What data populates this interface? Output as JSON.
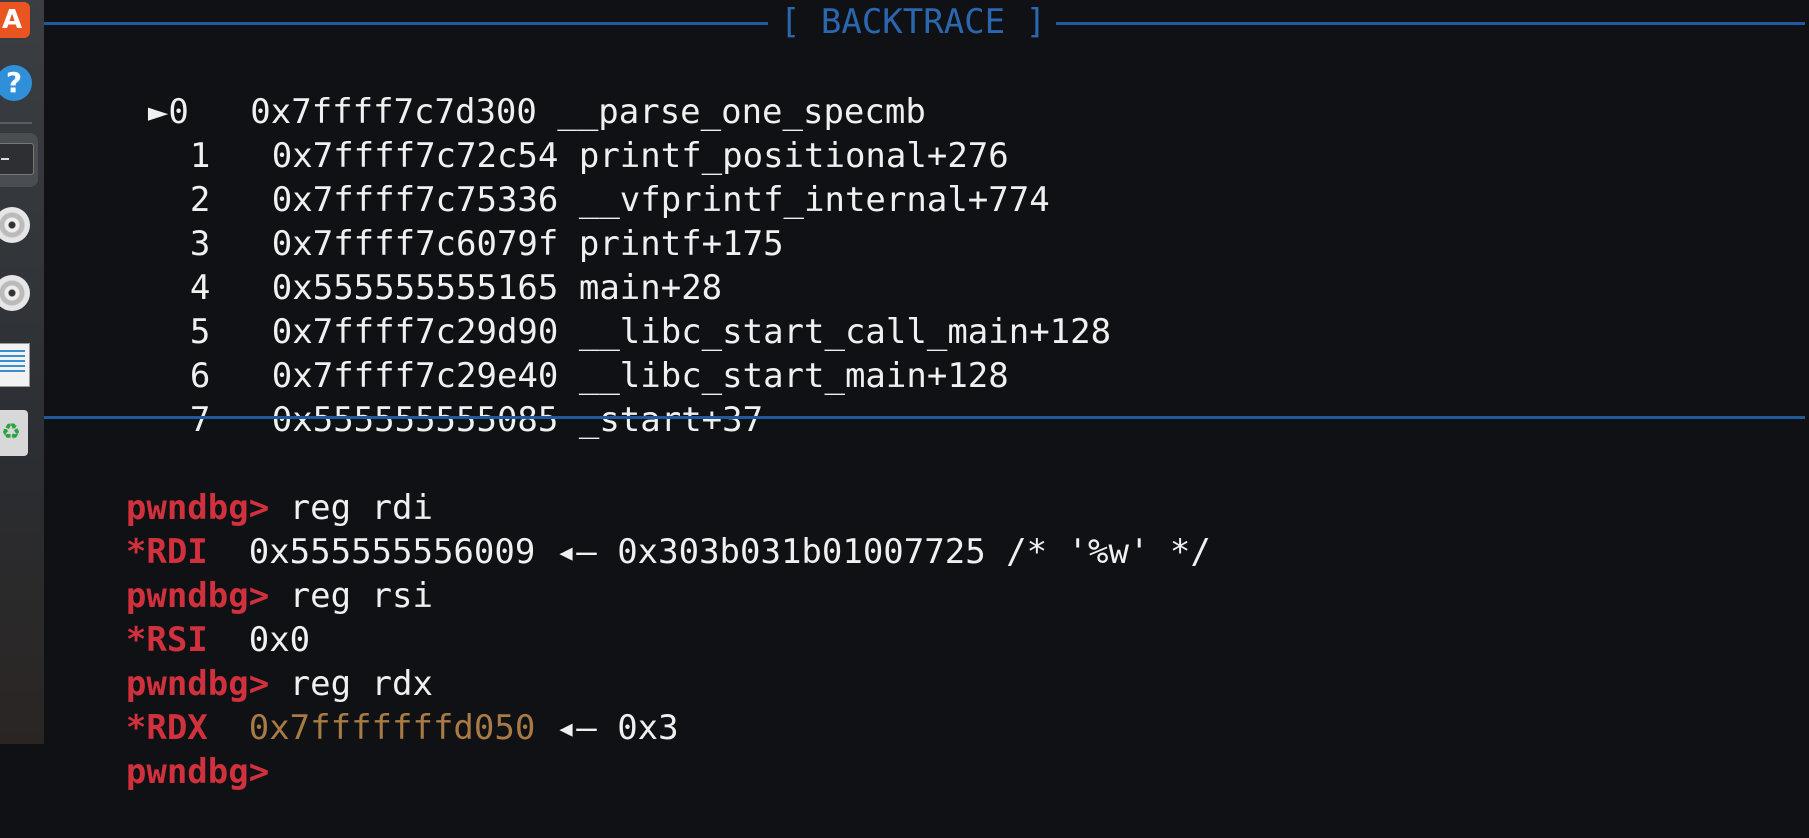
{
  "dock": {
    "items": [
      "app-store",
      "help",
      "terminal",
      "disc",
      "disc",
      "text-editor",
      "trash"
    ]
  },
  "backtrace": {
    "title": "[ BACKTRACE ]",
    "marker": "►",
    "frames": [
      {
        "index": "0",
        "address": "0x7ffff7c7d300",
        "symbol": "__parse_one_specmb"
      },
      {
        "index": "1",
        "address": "0x7ffff7c72c54",
        "symbol": "printf_positional+276"
      },
      {
        "index": "2",
        "address": "0x7ffff7c75336",
        "symbol": "__vfprintf_internal+774"
      },
      {
        "index": "3",
        "address": "0x7ffff7c6079f",
        "symbol": "printf+175"
      },
      {
        "index": "4",
        "address": "0x555555555165",
        "symbol": "main+28"
      },
      {
        "index": "5",
        "address": "0x7ffff7c29d90",
        "symbol": "__libc_start_call_main+128"
      },
      {
        "index": "6",
        "address": "0x7ffff7c29e40",
        "symbol": "__libc_start_main+128"
      },
      {
        "index": "7",
        "address": "0x555555555085",
        "symbol": "_start+37"
      }
    ]
  },
  "session": {
    "prompt": "pwndbg>",
    "lines": [
      {
        "kind": "cmd",
        "text": " reg rdi"
      },
      {
        "kind": "reg",
        "reg": "*RDI",
        "value": "0x555555556009",
        "arrow": " ◂— ",
        "deref": "0x303b031b01007725 /* '%w' */"
      },
      {
        "kind": "cmd",
        "text": " reg rsi"
      },
      {
        "kind": "reg",
        "reg": "*RSI",
        "value": "0x0"
      },
      {
        "kind": "cmd",
        "text": " reg rdx"
      },
      {
        "kind": "reg",
        "reg": "*RDX",
        "value": "0x7fffffffd050",
        "arrow": " ◂— ",
        "deref": "0x3"
      },
      {
        "kind": "cmd",
        "text": ""
      }
    ]
  },
  "colors": {
    "background": "#101114",
    "prompt": "#d0313d",
    "rule": "#1f5a9e",
    "stack_address": "#a87a44"
  }
}
